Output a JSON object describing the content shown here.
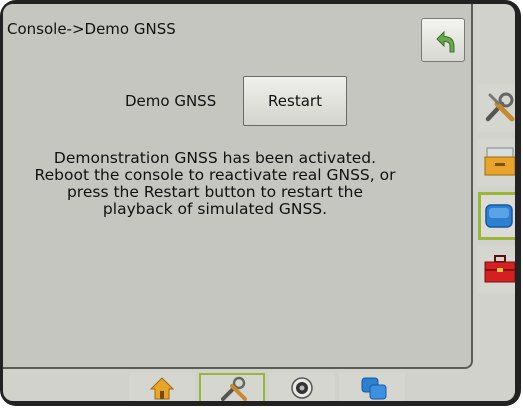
{
  "header": {
    "breadcrumb": "Console->Demo GNSS",
    "back_icon": "back-arrow-icon"
  },
  "main": {
    "demo_label": "Demo GNSS",
    "restart_label": "Restart",
    "message_lines": [
      "Demonstration GNSS has been activated.",
      "Reboot the console to reactivate real GNSS, or",
      "press the Restart button to restart the",
      "playback of simulated GNSS."
    ]
  },
  "side_tabs": [
    {
      "icon": "tools-icon",
      "active": false
    },
    {
      "icon": "file-drawer-icon",
      "active": false
    },
    {
      "icon": "console-icon",
      "active": true
    },
    {
      "icon": "toolbox-icon",
      "active": false
    }
  ],
  "bottom_tabs": [
    {
      "icon": "home-icon",
      "active": false
    },
    {
      "icon": "tools-icon",
      "active": true
    },
    {
      "icon": "camera-icon",
      "active": false
    },
    {
      "icon": "console-devices-icon",
      "active": false
    }
  ],
  "colors": {
    "screen_bg": "#c6c6c1",
    "active_border": "#9ab53a",
    "back_arrow": "#6aa84f",
    "device_frame": "#222222"
  }
}
